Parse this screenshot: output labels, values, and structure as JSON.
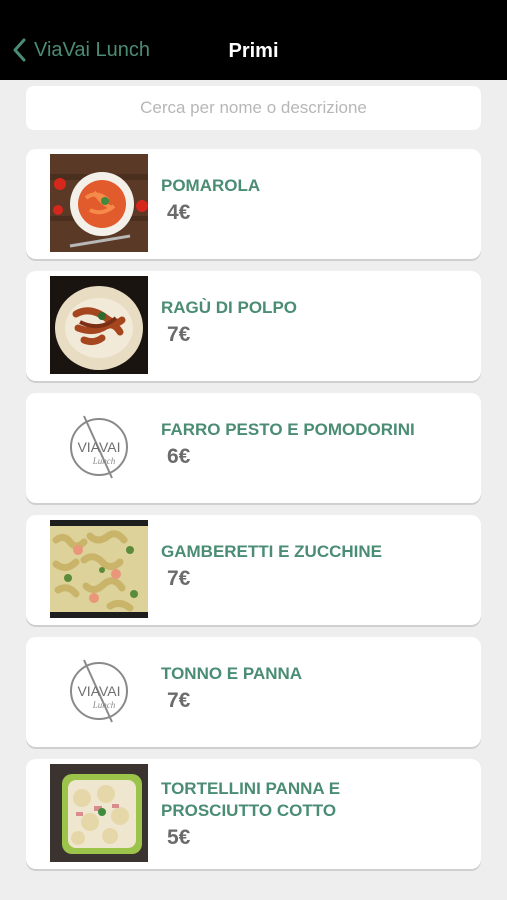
{
  "nav": {
    "back_label": "ViaVai Lunch",
    "title": "Primi"
  },
  "search": {
    "placeholder": "Cerca per nome o descrizione"
  },
  "items": [
    {
      "name": "POMAROLA",
      "price": "4€",
      "image": "pasta-tomato-photo"
    },
    {
      "name": "RAGÙ DI POLPO",
      "price": "7€",
      "image": "octopus-ragu-photo"
    },
    {
      "name": "FARRO PESTO E POMODORINI",
      "price": "6€",
      "image": "viavai-logo"
    },
    {
      "name": "GAMBERETTI E ZUCCHINE",
      "price": "7€",
      "image": "shrimp-zucchini-photo"
    },
    {
      "name": "TONNO E PANNA",
      "price": "7€",
      "image": "viavai-logo"
    },
    {
      "name": "TORTELLINI PANNA E PROSCIUTTO COTTO",
      "price": "5€",
      "image": "tortellini-photo"
    }
  ],
  "logo": {
    "brand": "VIAVAI",
    "sub": "Lunch"
  },
  "colors": {
    "accent": "#4a8c74",
    "price": "#6b6b6b",
    "nav_bg": "#000000",
    "page_bg": "#eeeeee"
  }
}
